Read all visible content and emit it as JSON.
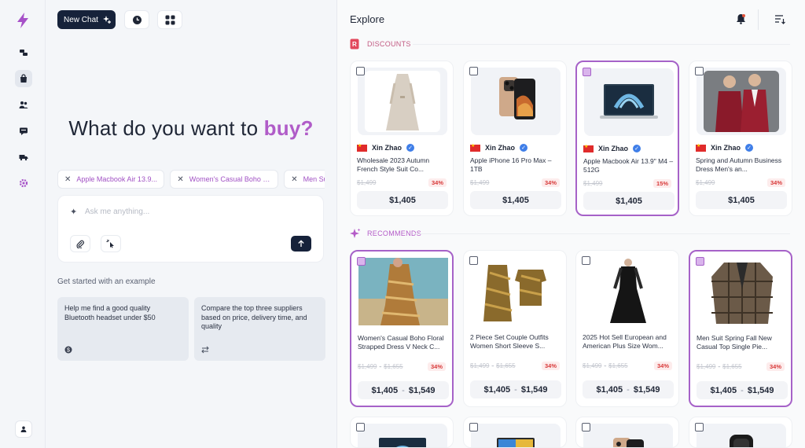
{
  "nav": {
    "items": [
      "chat",
      "shop",
      "users",
      "messages",
      "shipping",
      "settings"
    ],
    "active": "shop",
    "accent": "#a651c8"
  },
  "left": {
    "new_chat_label": "New Chat",
    "headline_prefix": "What do you want to ",
    "headline_accent": "buy?",
    "chips": [
      "Apple Macbook Air 13.9...",
      "Women's Casual Boho Flor...",
      "Men Suit Spring Fall New"
    ],
    "ask_placeholder": "Ask me anything...",
    "get_started": "Get started with an example",
    "examples": [
      {
        "text": "Help me find a good quality Bluetooth headset under $50",
        "icon": "dollar-icon"
      },
      {
        "text": "Compare the top three suppliers based on price, delivery time, and quality",
        "icon": "compare-arrows-icon"
      }
    ]
  },
  "explore": {
    "title": "Explore",
    "discounts_label": "DISCOUNTS",
    "recommends_label": "RECOMMENDS",
    "discounts": [
      {
        "seller": "Xin Zhao",
        "title": "Wholesale 2023 Autumn French Style Suit Co...",
        "old_price": "$1,499",
        "discount": "34%",
        "price": "$1,405",
        "selected": false,
        "image": "trench-dress"
      },
      {
        "seller": "Xin Zhao",
        "title": "Apple iPhone 16 Pro Max – 1TB",
        "old_price": "$1,499",
        "discount": "34%",
        "price": "$1,405",
        "selected": false,
        "image": "iphone"
      },
      {
        "seller": "Xin Zhao",
        "title": "Apple Macbook Air 13.9\" M4 – 512G",
        "old_price": "$1,499",
        "discount": "15%",
        "price": "$1,405",
        "selected": true,
        "image": "macbook"
      },
      {
        "seller": "Xin Zhao",
        "title": "Spring and Autumn Business Dress Men's an...",
        "old_price": "$1,499",
        "discount": "34%",
        "price": "$1,405",
        "selected": false,
        "image": "suits-couple"
      }
    ],
    "recommends": [
      {
        "title": "Women's Casual Boho Floral Strapped Dress V Neck C...",
        "old_low": "$1,499",
        "old_high": "$1,655",
        "discount": "34%",
        "price_low": "$1,405",
        "price_high": "$1,549",
        "selected": true,
        "image": "boho-dress"
      },
      {
        "title": "2 Piece Set Couple Outfits Women Short Sleeve S...",
        "old_low": "$1,499",
        "old_high": "$1,655",
        "discount": "34%",
        "price_low": "$1,405",
        "price_high": "$1,549",
        "selected": false,
        "image": "couple-outfit"
      },
      {
        "title": "2025 Hot Sell European and American Plus Size Wom...",
        "old_low": "$1,499",
        "old_high": "$1,655",
        "discount": "34%",
        "price_low": "$1,405",
        "price_high": "$1,549",
        "selected": false,
        "image": "black-dress"
      },
      {
        "title": "Men Suit Spring Fall New Casual Top Single Pie...",
        "old_low": "$1,499",
        "old_high": "$1,655",
        "discount": "34%",
        "price_low": "$1,405",
        "price_high": "$1,549",
        "selected": true,
        "image": "plaid-blazer"
      }
    ],
    "third_row": [
      "macbook-thumb",
      "monitor-thumb",
      "iphone-thumb",
      "watch-thumb"
    ]
  }
}
